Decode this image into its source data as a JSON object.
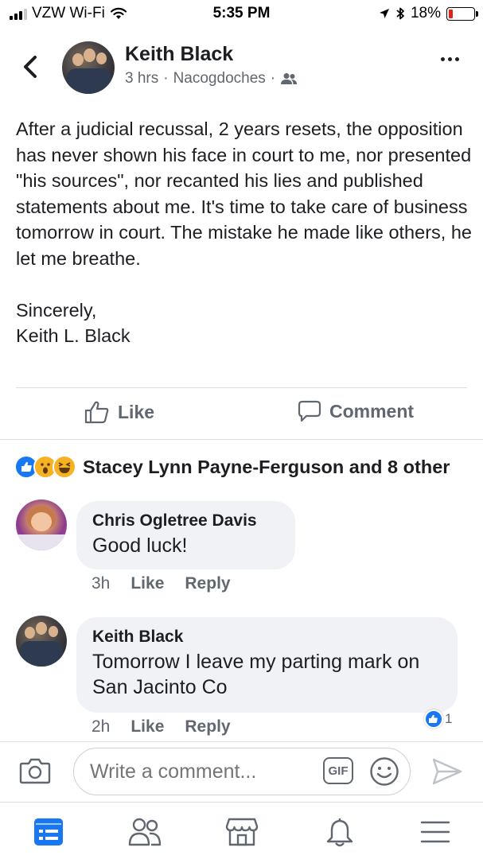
{
  "status_bar": {
    "carrier": "VZW Wi-Fi",
    "time": "5:35 PM",
    "battery": "18%",
    "battery_level": 0.18
  },
  "post": {
    "author": "Keith Black",
    "time": "3 hrs",
    "separator": "·",
    "location": "Nacogdoches",
    "audience_icon": "friends-icon",
    "body": "After a judicial recussal, 2 years resets, the opposition has never shown his face in court to me, nor presented \"his sources\",  nor recanted his lies and published statements about me.  It's time to take care of business tomorrow in court. The mistake he made like others, he let me breathe.\n\nSincerely,\nKeith L. Black"
  },
  "actions": {
    "like": "Like",
    "comment": "Comment"
  },
  "reactions": {
    "icons": [
      "like-reaction-icon",
      "wow-reaction-icon",
      "haha-reaction-icon"
    ],
    "summary": "Stacey Lynn Payne-Ferguson and 8 other"
  },
  "comments": [
    {
      "author": "Chris Ogletree Davis",
      "text": "Good luck!",
      "time": "3h",
      "like": "Like",
      "reply": "Reply"
    },
    {
      "author": "Keith Black",
      "text": "Tomorrow I leave my parting mark on San Jacinto Co",
      "time": "2h",
      "like": "Like",
      "reply": "Reply",
      "like_count": "1"
    }
  ],
  "composer": {
    "placeholder": "Write a comment...",
    "gif_label": "GIF"
  },
  "bottom_nav": [
    "news-feed-icon",
    "friends-icon",
    "marketplace-icon",
    "notifications-icon",
    "menu-icon"
  ],
  "colors": {
    "accent": "#1877f2",
    "text": "#1c1e21",
    "secondary": "#606770",
    "bubble": "#f0f2f5",
    "battery_low": "#e0231a"
  }
}
